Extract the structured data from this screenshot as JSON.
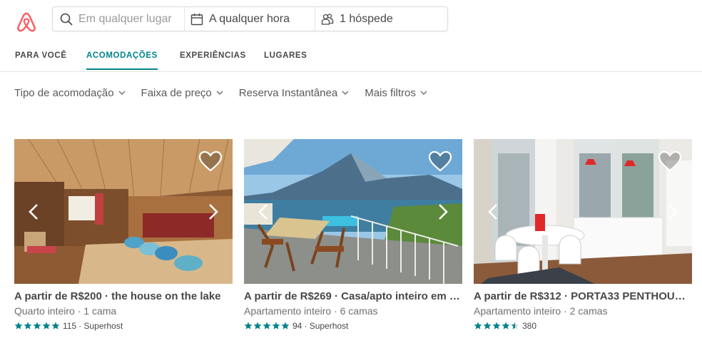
{
  "brand": {
    "color": "#ff5a5f",
    "accent": "#008489"
  },
  "search": {
    "location_placeholder": "Em qualquer lugar",
    "dates": "A qualquer hora",
    "guests": "1 hóspede"
  },
  "nav": {
    "tabs": [
      {
        "label": "PARA VOCÊ"
      },
      {
        "label": "ACOMODAÇÕES",
        "active": true
      },
      {
        "label": "EXPERIÊNCIAS"
      },
      {
        "label": "LUGARES"
      }
    ]
  },
  "filters": [
    {
      "label": "Tipo de acomodação"
    },
    {
      "label": "Faixa de preço"
    },
    {
      "label": "Reserva Instantânea"
    },
    {
      "label": "Mais filtros"
    }
  ],
  "listings": [
    {
      "title": "A partir de R$200 · the house on the lake",
      "subtitle": "Quarto inteiro · 1 cama",
      "rating": 5,
      "reviews": "115",
      "badge": "· Superhost"
    },
    {
      "title": "A partir de R$269 · Casa/apto inteiro em …",
      "subtitle": "Apartamento inteiro · 6 camas",
      "rating": 5,
      "reviews": "94",
      "badge": "· Superhost"
    },
    {
      "title": "A partir de R$312 · PORTA33 PENTHOUSE…",
      "subtitle": "Apartamento inteiro · 2 camas",
      "rating": 4.5,
      "reviews": "380",
      "badge": ""
    }
  ]
}
